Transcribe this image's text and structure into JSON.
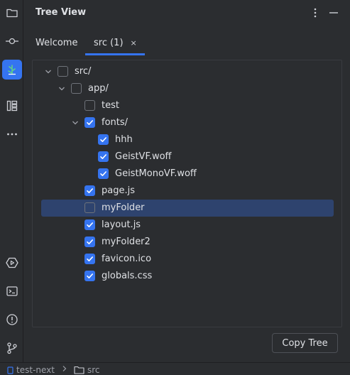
{
  "panel": {
    "title": "Tree View"
  },
  "tabs": [
    {
      "label": "Welcome",
      "active": false
    },
    {
      "label": "src (1)",
      "active": true,
      "close": "×"
    }
  ],
  "tree": [
    {
      "label": "src/",
      "level": 0,
      "expandable": true,
      "expanded": true,
      "checked": false
    },
    {
      "label": "app/",
      "level": 1,
      "expandable": true,
      "expanded": true,
      "checked": false
    },
    {
      "label": "test",
      "level": 2,
      "expandable": false,
      "checked": false
    },
    {
      "label": "fonts/",
      "level": 2,
      "expandable": true,
      "expanded": true,
      "checked": true
    },
    {
      "label": "hhh",
      "level": 3,
      "expandable": false,
      "checked": true
    },
    {
      "label": "GeistVF.woff",
      "level": 3,
      "expandable": false,
      "checked": true
    },
    {
      "label": "GeistMonoVF.woff",
      "level": 3,
      "expandable": false,
      "checked": true
    },
    {
      "label": "page.js",
      "level": 2,
      "expandable": false,
      "checked": true
    },
    {
      "label": "myFolder",
      "level": 2,
      "expandable": false,
      "checked": false,
      "selected": true
    },
    {
      "label": "layout.js",
      "level": 2,
      "expandable": false,
      "checked": true
    },
    {
      "label": "myFolder2",
      "level": 2,
      "expandable": false,
      "checked": true
    },
    {
      "label": "favicon.ico",
      "level": 2,
      "expandable": false,
      "checked": true
    },
    {
      "label": "globals.css",
      "level": 2,
      "expandable": false,
      "checked": true
    }
  ],
  "actions": {
    "copy_tree": "Copy Tree"
  },
  "statusbar": {
    "project": "test-next",
    "folder": "src"
  },
  "colors": {
    "accent": "#3574f0",
    "selection": "#2e436e",
    "background": "#2b2d30"
  },
  "strip_icons": [
    "folder-icon",
    "commit-icon",
    "tree-view-icon",
    "structure-icon",
    "more-icon",
    "run-icon",
    "terminal-icon",
    "problems-icon",
    "git-icon"
  ]
}
